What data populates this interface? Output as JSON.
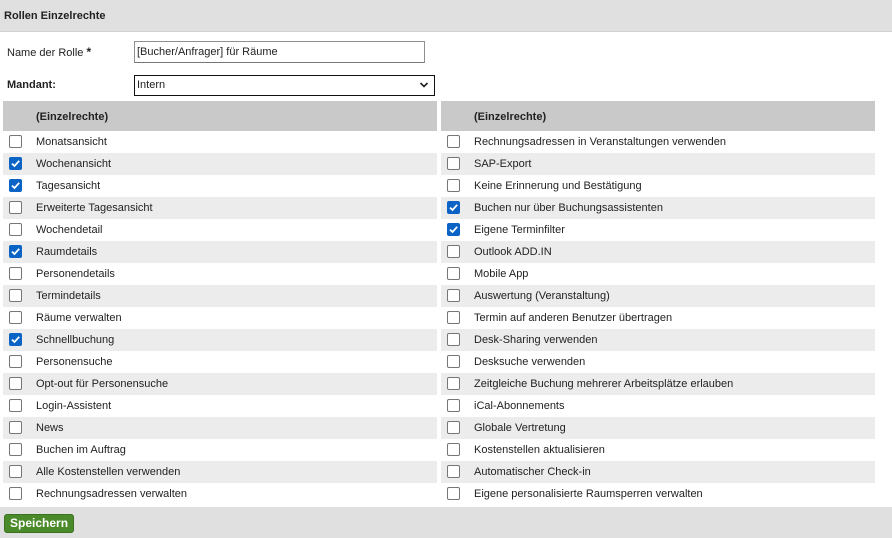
{
  "header": {
    "title": "Rollen Einzelrechte"
  },
  "form": {
    "name_label": "Name der Rolle",
    "required_mark": "*",
    "name_value": "[Bucher/Anfrager] für Räume",
    "mandant_label": "Mandant:",
    "mandant_value": "Intern"
  },
  "permissions": {
    "left": {
      "header": "(Einzelrechte)",
      "items": [
        {
          "label": "Monatsansicht",
          "checked": false
        },
        {
          "label": "Wochenansicht",
          "checked": true
        },
        {
          "label": "Tagesansicht",
          "checked": true
        },
        {
          "label": "Erweiterte Tagesansicht",
          "checked": false
        },
        {
          "label": "Wochendetail",
          "checked": false
        },
        {
          "label": "Raumdetails",
          "checked": true
        },
        {
          "label": "Personendetails",
          "checked": false
        },
        {
          "label": "Termindetails",
          "checked": false
        },
        {
          "label": "Räume verwalten",
          "checked": false
        },
        {
          "label": "Schnellbuchung",
          "checked": true
        },
        {
          "label": "Personensuche",
          "checked": false
        },
        {
          "label": "Opt-out für Personensuche",
          "checked": false
        },
        {
          "label": "Login-Assistent",
          "checked": false
        },
        {
          "label": "News",
          "checked": false
        },
        {
          "label": "Buchen im Auftrag",
          "checked": false
        },
        {
          "label": "Alle Kostenstellen verwenden",
          "checked": false
        },
        {
          "label": "Rechnungsadressen verwalten",
          "checked": false
        }
      ]
    },
    "right": {
      "header": "(Einzelrechte)",
      "items": [
        {
          "label": "Rechnungsadressen in Veranstaltungen verwenden",
          "checked": false
        },
        {
          "label": "SAP-Export",
          "checked": false
        },
        {
          "label": "Keine Erinnerung und Bestätigung",
          "checked": false
        },
        {
          "label": "Buchen nur über Buchungsassistenten",
          "checked": true
        },
        {
          "label": "Eigene Terminfilter",
          "checked": true
        },
        {
          "label": "Outlook ADD.IN",
          "checked": false
        },
        {
          "label": "Mobile App",
          "checked": false
        },
        {
          "label": "Auswertung (Veranstaltung)",
          "checked": false
        },
        {
          "label": "Termin auf anderen Benutzer übertragen",
          "checked": false
        },
        {
          "label": "Desk-Sharing verwenden",
          "checked": false
        },
        {
          "label": "Desksuche verwenden",
          "checked": false
        },
        {
          "label": "Zeitgleiche Buchung mehrerer Arbeitsplätze erlauben",
          "checked": false
        },
        {
          "label": "iCal-Abonnements",
          "checked": false
        },
        {
          "label": "Globale Vertretung",
          "checked": false
        },
        {
          "label": "Kostenstellen aktualisieren",
          "checked": false
        },
        {
          "label": "Automatischer Check-in",
          "checked": false
        },
        {
          "label": "Eigene personalisierte Raumsperren verwalten",
          "checked": false
        }
      ]
    }
  },
  "footer": {
    "save_label": "Speichern"
  },
  "colors": {
    "accent_checkbox": "#0b63c5",
    "save_button": "#4a8a2a",
    "header_bg": "#c9c9c9",
    "alt_row": "#ececec"
  }
}
